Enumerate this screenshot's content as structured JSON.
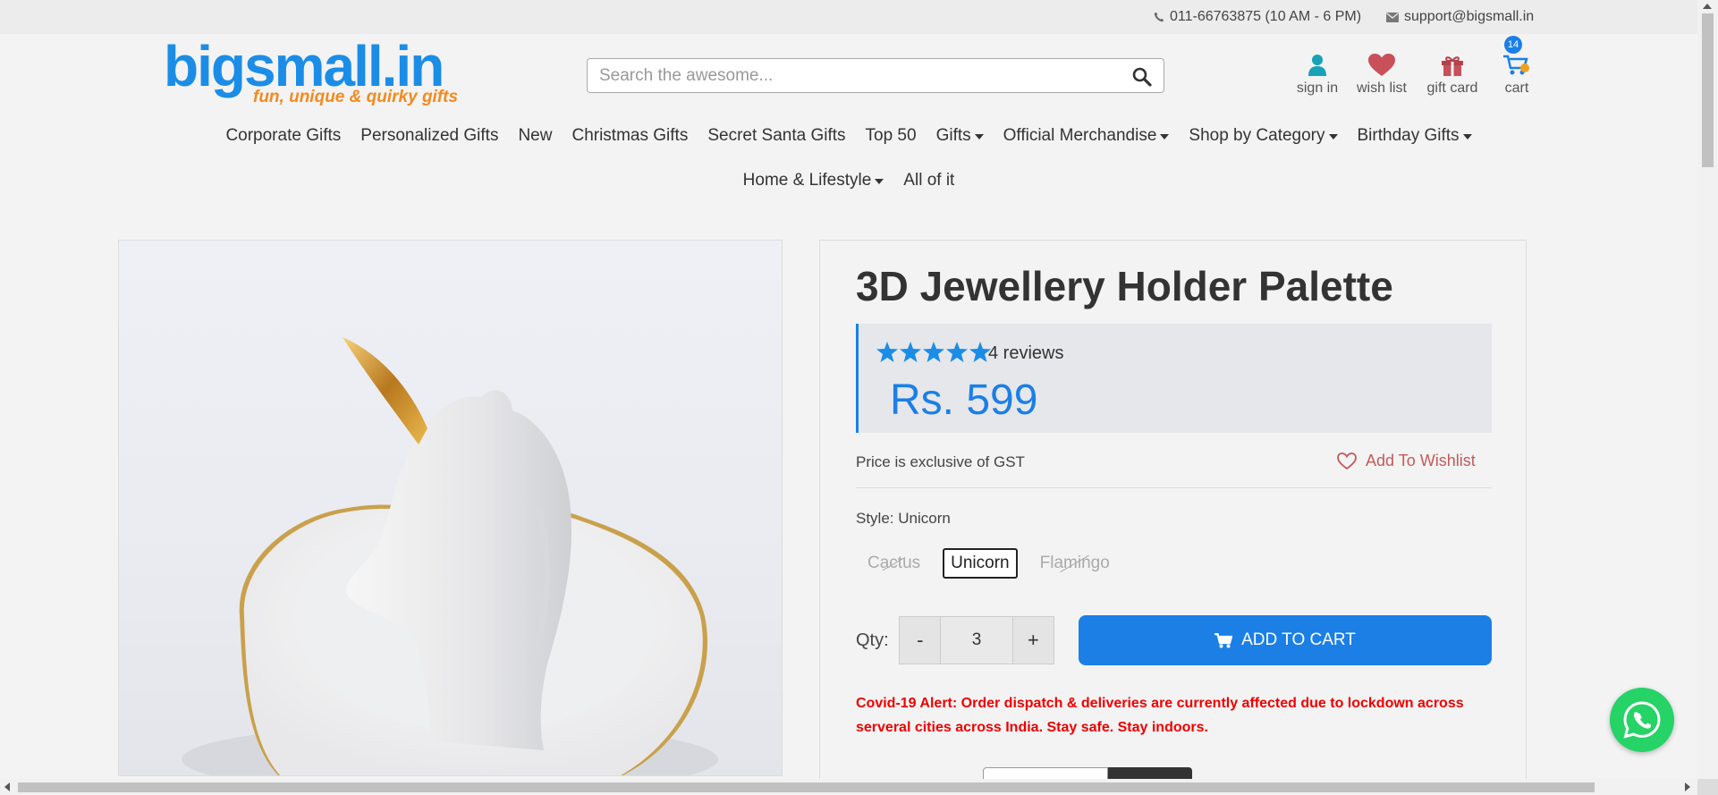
{
  "topbar": {
    "phone": "011-66763875 (10 AM - 6 PM)",
    "email": "support@bigsmall.in"
  },
  "logo": {
    "text": "bigsmall.in",
    "tagline": "fun, unique & quirky gifts"
  },
  "search": {
    "placeholder": "Search the awesome..."
  },
  "header_links": {
    "sign_in": "sign in",
    "wish_list": "wish list",
    "gift_card": "gift card",
    "cart": "cart",
    "cart_count": "14"
  },
  "nav": {
    "row1": [
      {
        "label": "Corporate Gifts",
        "dropdown": false
      },
      {
        "label": "Personalized Gifts",
        "dropdown": false
      },
      {
        "label": "New",
        "dropdown": false
      },
      {
        "label": "Christmas Gifts",
        "dropdown": false
      },
      {
        "label": "Secret Santa Gifts",
        "dropdown": false
      },
      {
        "label": "Top 50",
        "dropdown": false
      },
      {
        "label": "Gifts",
        "dropdown": true
      },
      {
        "label": "Official Merchandise",
        "dropdown": true
      },
      {
        "label": "Shop by Category",
        "dropdown": true
      },
      {
        "label": "Birthday Gifts",
        "dropdown": true
      }
    ],
    "row2": [
      {
        "label": "Home & Lifestyle",
        "dropdown": true
      },
      {
        "label": "All of it",
        "dropdown": false
      }
    ]
  },
  "product": {
    "title": "3D Jewellery Holder Palette",
    "rating": 5,
    "reviews": "4 reviews",
    "price": "Rs. 599",
    "gst_note": "Price is exclusive of GST",
    "wishlist_label": "Add To Wishlist",
    "style_label": "Style: Unicorn",
    "style_options": [
      {
        "label": "Cactus",
        "available": false,
        "selected": false
      },
      {
        "label": "Unicorn",
        "available": true,
        "selected": true
      },
      {
        "label": "Flamingo",
        "available": false,
        "selected": false
      }
    ],
    "qty_label": "Qty:",
    "qty_minus": "-",
    "qty_value": "3",
    "qty_plus": "+",
    "add_to_cart": "ADD TO CART",
    "covid_alert": "Covid-19 Alert: Order dispatch & deliveries are currently affected due to lockdown across serveral cities across India. Stay safe. Stay indoors."
  },
  "colors": {
    "brand_blue": "#1b7fe6",
    "logo_orange": "#f28a1e",
    "alert_red": "#ee0000",
    "whatsapp_green": "#25d366"
  },
  "icons": {
    "phone": "phone-icon",
    "email": "envelope-icon",
    "search": "search-icon",
    "sign_in": "user-icon",
    "wish_list": "heart-icon",
    "gift_card": "gift-icon",
    "cart": "cart-icon",
    "wishlist_button": "heart-outline-icon",
    "add_to_cart": "cart-icon",
    "whatsapp": "whatsapp-icon"
  }
}
